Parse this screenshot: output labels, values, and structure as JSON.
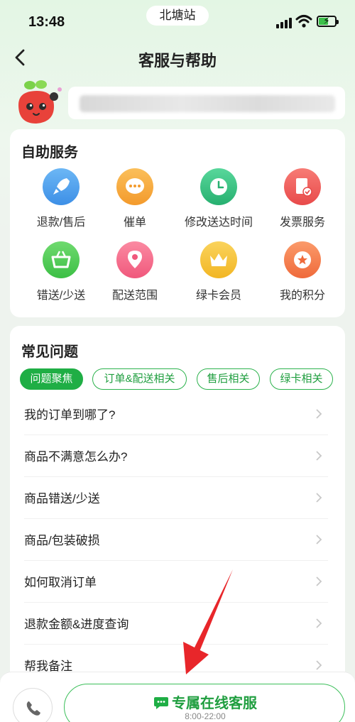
{
  "status_bar": {
    "time": "13:48",
    "location": "北塘站",
    "icons": [
      "cellular-signal-icon",
      "wifi-icon",
      "battery-charging-icon"
    ]
  },
  "nav": {
    "back_icon": "chevron-left-icon",
    "title": "客服与帮助"
  },
  "profile": {
    "avatar_icon": "radish-mascot-icon",
    "name": ""
  },
  "self_service": {
    "title": "自助服务",
    "items": [
      {
        "label": "退款/售后",
        "icon": "rocket-icon",
        "color": "#4da3f0"
      },
      {
        "label": "催单",
        "icon": "chat-dots-icon",
        "color": "#f6a840"
      },
      {
        "label": "修改送达时间",
        "icon": "clock-icon",
        "color": "#3ec78a"
      },
      {
        "label": "发票服务",
        "icon": "invoice-icon",
        "color": "#f26060"
      },
      {
        "label": "错送/少送",
        "icon": "basket-icon",
        "color": "#52c85a"
      },
      {
        "label": "配送范围",
        "icon": "location-pin-icon",
        "color": "#f36f8a"
      },
      {
        "label": "绿卡会员",
        "icon": "crown-icon",
        "color": "#f5c33b"
      },
      {
        "label": "我的积分",
        "icon": "star-badge-icon",
        "color": "#f47a4a"
      }
    ]
  },
  "faq": {
    "title": "常见问题",
    "tabs": [
      {
        "label": "问题聚焦",
        "active": true
      },
      {
        "label": "订单&配送相关",
        "active": false
      },
      {
        "label": "售后相关",
        "active": false
      },
      {
        "label": "绿卡相关",
        "active": false
      }
    ],
    "questions": [
      "我的订单到哪了?",
      "商品不满意怎么办?",
      "商品错送/少送",
      "商品/包装破损",
      "如何取消订单",
      "退款金额&进度查询",
      "帮我备注"
    ]
  },
  "bottom_bar": {
    "phone_icon": "phone-icon",
    "cs_label": "专属在线客服",
    "cs_hours": "8:00-22:00",
    "cs_icon": "chat-bubble-icon"
  },
  "colors": {
    "accent": "#1fae45",
    "annotation_arrow": "#e8262a"
  }
}
